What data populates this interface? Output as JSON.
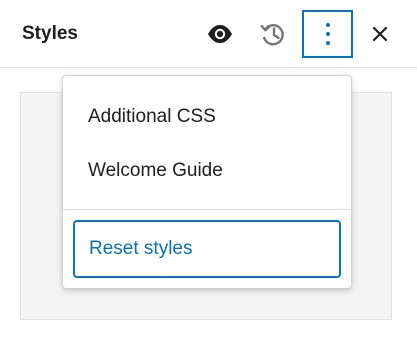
{
  "header": {
    "title": "Styles",
    "actions": [
      {
        "icon": "eye-icon",
        "label": "Style preview"
      },
      {
        "icon": "history-icon",
        "label": "Revisions"
      },
      {
        "icon": "more-vertical-icon",
        "label": "More"
      },
      {
        "icon": "close-icon",
        "label": "Close"
      }
    ]
  },
  "menu": {
    "items": [
      {
        "label": "Additional CSS"
      },
      {
        "label": "Welcome Guide"
      }
    ],
    "reset_label": "Reset styles"
  },
  "colors": {
    "accent": "#0a72b6",
    "text": "#1e1e1e",
    "border": "#e0e0e0",
    "preview_bg": "#f4f4f5"
  }
}
